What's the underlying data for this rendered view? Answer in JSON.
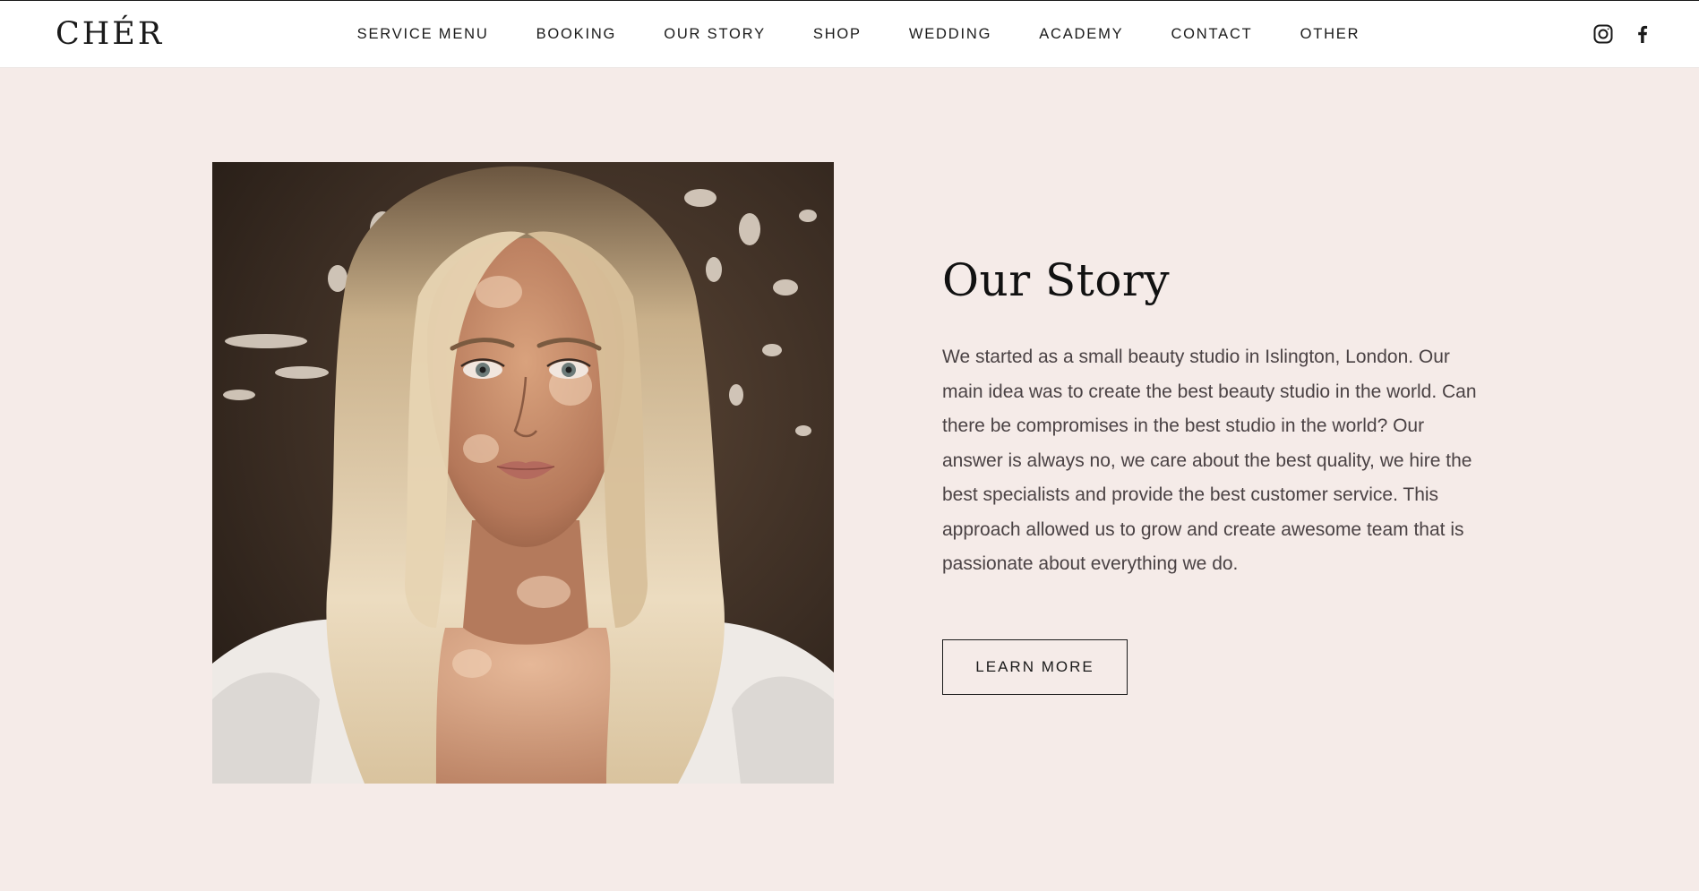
{
  "header": {
    "logo": "CHÉR",
    "nav": [
      "SERVICE MENU",
      "BOOKING",
      "OUR STORY",
      "SHOP",
      "WEDDING",
      "ACADEMY",
      "CONTACT",
      "OTHER"
    ],
    "social": {
      "instagram_icon": "instagram-icon",
      "facebook_icon": "facebook-icon"
    }
  },
  "hero": {
    "image_icon": "portrait-photo",
    "title": "Our Story",
    "body": "We started as a small beauty studio in Islington, London. Our main idea was to create the best beauty studio in the world. Can there be compromises in the best studio in the world? Our answer is always no, we care about the best quality, we hire the best specialists and provide the best customer service. This approach allowed us to grow and create awesome team that is passionate about everything we do.",
    "button_label": "LEARN MORE"
  },
  "colors": {
    "page_background": "#f5ebe8",
    "header_background": "#ffffff",
    "text_dark": "#1a1a1a",
    "body_text": "#4a4244"
  }
}
